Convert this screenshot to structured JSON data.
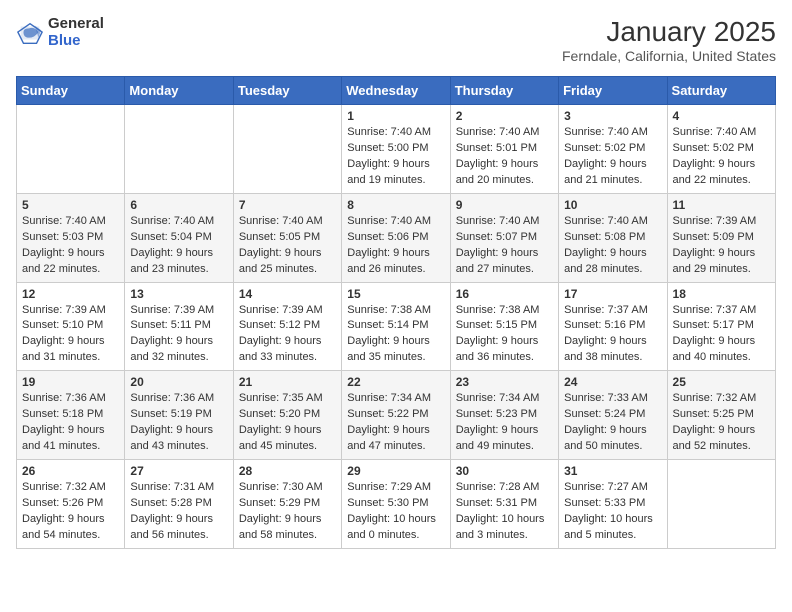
{
  "header": {
    "logo_general": "General",
    "logo_blue": "Blue",
    "month_title": "January 2025",
    "location": "Ferndale, California, United States"
  },
  "weekdays": [
    "Sunday",
    "Monday",
    "Tuesday",
    "Wednesday",
    "Thursday",
    "Friday",
    "Saturday"
  ],
  "weeks": [
    [
      {
        "day": "",
        "info": ""
      },
      {
        "day": "",
        "info": ""
      },
      {
        "day": "",
        "info": ""
      },
      {
        "day": "1",
        "info": "Sunrise: 7:40 AM\nSunset: 5:00 PM\nDaylight: 9 hours and 19 minutes."
      },
      {
        "day": "2",
        "info": "Sunrise: 7:40 AM\nSunset: 5:01 PM\nDaylight: 9 hours and 20 minutes."
      },
      {
        "day": "3",
        "info": "Sunrise: 7:40 AM\nSunset: 5:02 PM\nDaylight: 9 hours and 21 minutes."
      },
      {
        "day": "4",
        "info": "Sunrise: 7:40 AM\nSunset: 5:02 PM\nDaylight: 9 hours and 22 minutes."
      }
    ],
    [
      {
        "day": "5",
        "info": "Sunrise: 7:40 AM\nSunset: 5:03 PM\nDaylight: 9 hours and 22 minutes."
      },
      {
        "day": "6",
        "info": "Sunrise: 7:40 AM\nSunset: 5:04 PM\nDaylight: 9 hours and 23 minutes."
      },
      {
        "day": "7",
        "info": "Sunrise: 7:40 AM\nSunset: 5:05 PM\nDaylight: 9 hours and 25 minutes."
      },
      {
        "day": "8",
        "info": "Sunrise: 7:40 AM\nSunset: 5:06 PM\nDaylight: 9 hours and 26 minutes."
      },
      {
        "day": "9",
        "info": "Sunrise: 7:40 AM\nSunset: 5:07 PM\nDaylight: 9 hours and 27 minutes."
      },
      {
        "day": "10",
        "info": "Sunrise: 7:40 AM\nSunset: 5:08 PM\nDaylight: 9 hours and 28 minutes."
      },
      {
        "day": "11",
        "info": "Sunrise: 7:39 AM\nSunset: 5:09 PM\nDaylight: 9 hours and 29 minutes."
      }
    ],
    [
      {
        "day": "12",
        "info": "Sunrise: 7:39 AM\nSunset: 5:10 PM\nDaylight: 9 hours and 31 minutes."
      },
      {
        "day": "13",
        "info": "Sunrise: 7:39 AM\nSunset: 5:11 PM\nDaylight: 9 hours and 32 minutes."
      },
      {
        "day": "14",
        "info": "Sunrise: 7:39 AM\nSunset: 5:12 PM\nDaylight: 9 hours and 33 minutes."
      },
      {
        "day": "15",
        "info": "Sunrise: 7:38 AM\nSunset: 5:14 PM\nDaylight: 9 hours and 35 minutes."
      },
      {
        "day": "16",
        "info": "Sunrise: 7:38 AM\nSunset: 5:15 PM\nDaylight: 9 hours and 36 minutes."
      },
      {
        "day": "17",
        "info": "Sunrise: 7:37 AM\nSunset: 5:16 PM\nDaylight: 9 hours and 38 minutes."
      },
      {
        "day": "18",
        "info": "Sunrise: 7:37 AM\nSunset: 5:17 PM\nDaylight: 9 hours and 40 minutes."
      }
    ],
    [
      {
        "day": "19",
        "info": "Sunrise: 7:36 AM\nSunset: 5:18 PM\nDaylight: 9 hours and 41 minutes."
      },
      {
        "day": "20",
        "info": "Sunrise: 7:36 AM\nSunset: 5:19 PM\nDaylight: 9 hours and 43 minutes."
      },
      {
        "day": "21",
        "info": "Sunrise: 7:35 AM\nSunset: 5:20 PM\nDaylight: 9 hours and 45 minutes."
      },
      {
        "day": "22",
        "info": "Sunrise: 7:34 AM\nSunset: 5:22 PM\nDaylight: 9 hours and 47 minutes."
      },
      {
        "day": "23",
        "info": "Sunrise: 7:34 AM\nSunset: 5:23 PM\nDaylight: 9 hours and 49 minutes."
      },
      {
        "day": "24",
        "info": "Sunrise: 7:33 AM\nSunset: 5:24 PM\nDaylight: 9 hours and 50 minutes."
      },
      {
        "day": "25",
        "info": "Sunrise: 7:32 AM\nSunset: 5:25 PM\nDaylight: 9 hours and 52 minutes."
      }
    ],
    [
      {
        "day": "26",
        "info": "Sunrise: 7:32 AM\nSunset: 5:26 PM\nDaylight: 9 hours and 54 minutes."
      },
      {
        "day": "27",
        "info": "Sunrise: 7:31 AM\nSunset: 5:28 PM\nDaylight: 9 hours and 56 minutes."
      },
      {
        "day": "28",
        "info": "Sunrise: 7:30 AM\nSunset: 5:29 PM\nDaylight: 9 hours and 58 minutes."
      },
      {
        "day": "29",
        "info": "Sunrise: 7:29 AM\nSunset: 5:30 PM\nDaylight: 10 hours and 0 minutes."
      },
      {
        "day": "30",
        "info": "Sunrise: 7:28 AM\nSunset: 5:31 PM\nDaylight: 10 hours and 3 minutes."
      },
      {
        "day": "31",
        "info": "Sunrise: 7:27 AM\nSunset: 5:33 PM\nDaylight: 10 hours and 5 minutes."
      },
      {
        "day": "",
        "info": ""
      }
    ]
  ]
}
